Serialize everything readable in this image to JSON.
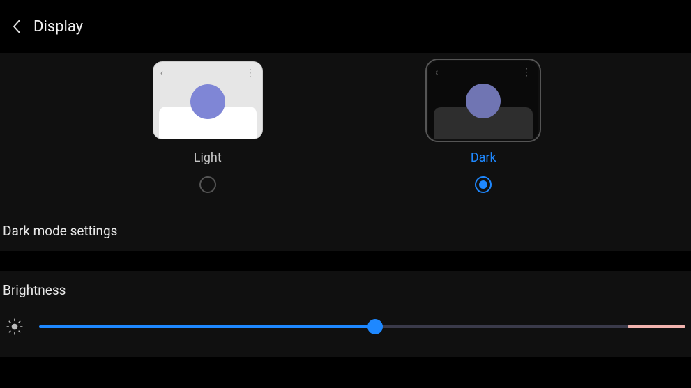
{
  "header": {
    "title": "Display"
  },
  "themes": {
    "light_label": "Light",
    "dark_label": "Dark",
    "selected": "dark"
  },
  "dark_mode_settings_label": "Dark mode settings",
  "brightness": {
    "label": "Brightness",
    "value_pct": 52,
    "warn_zone_pct": 9
  },
  "colors": {
    "accent": "#1e88ff",
    "preview_circle": "#7f86d6"
  }
}
